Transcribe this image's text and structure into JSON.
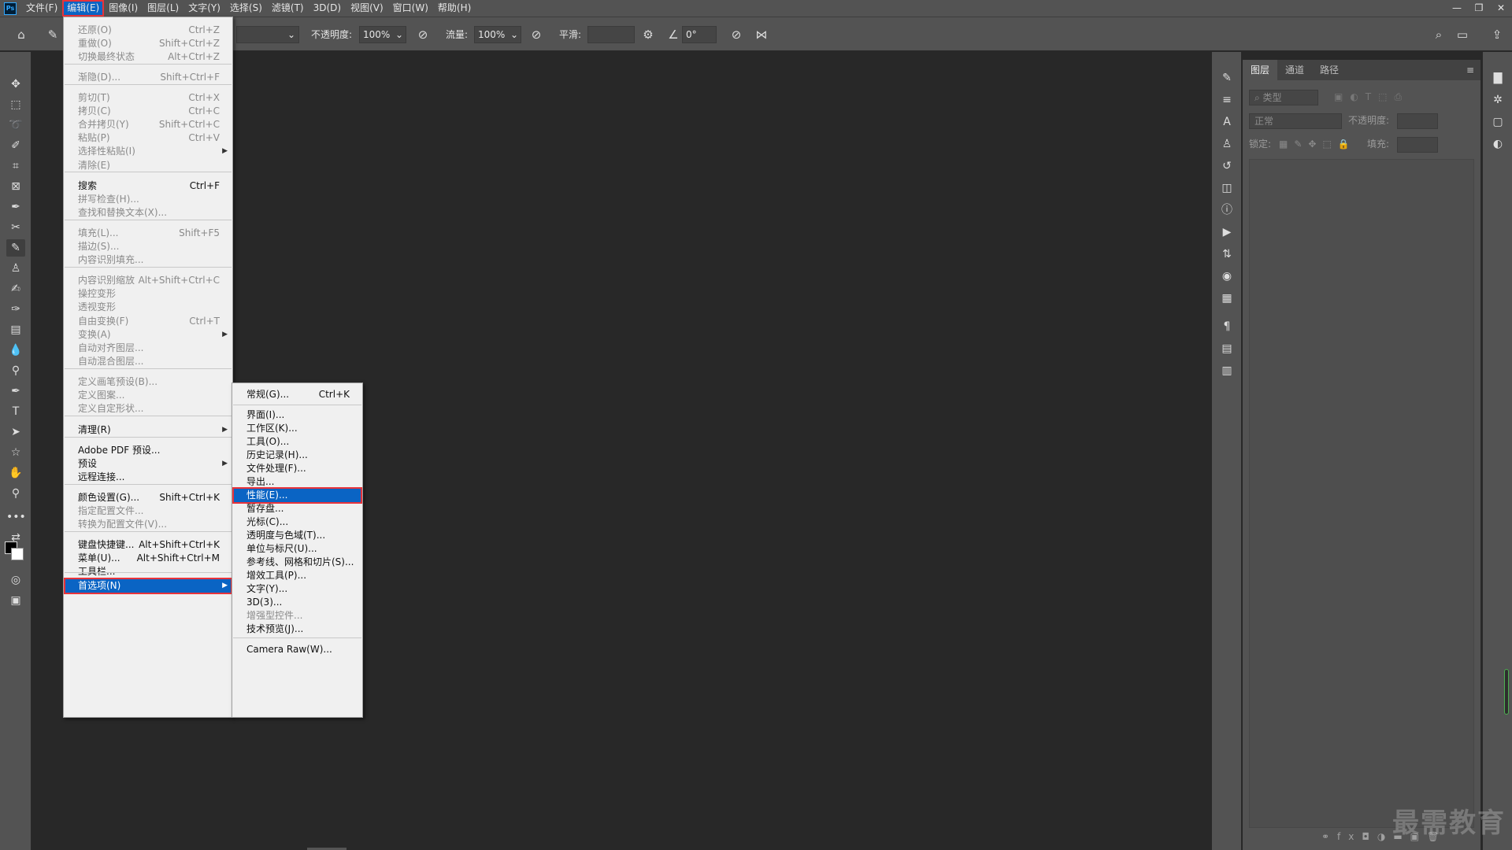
{
  "app": {
    "logo": "Ps"
  },
  "menubar": {
    "items": [
      "文件(F)",
      "编辑(E)",
      "图像(I)",
      "图层(L)",
      "文字(Y)",
      "选择(S)",
      "滤镜(T)",
      "3D(D)",
      "视图(V)",
      "窗口(W)",
      "帮助(H)"
    ],
    "active_index": 1,
    "window_controls": [
      "—",
      "❐",
      "✕"
    ]
  },
  "options": {
    "opacity_label": "不透明度:",
    "opacity_value": "100%",
    "flow_label": "流量:",
    "flow_value": "100%",
    "smoothing_label": "平滑:",
    "smoothing_value": "",
    "angle_value": "0°"
  },
  "edit_menu": {
    "items": [
      {
        "label": "还原(O)",
        "shortcut": "Ctrl+Z",
        "enabled": false
      },
      {
        "label": "重做(O)",
        "shortcut": "Shift+Ctrl+Z",
        "enabled": false
      },
      {
        "label": "切换最终状态",
        "shortcut": "Alt+Ctrl+Z",
        "enabled": false
      },
      {
        "label": "渐隐(D)...",
        "shortcut": "Shift+Ctrl+F",
        "enabled": false
      },
      {
        "label": "剪切(T)",
        "shortcut": "Ctrl+X",
        "enabled": false
      },
      {
        "label": "拷贝(C)",
        "shortcut": "Ctrl+C",
        "enabled": false
      },
      {
        "label": "合并拷贝(Y)",
        "shortcut": "Shift+Ctrl+C",
        "enabled": false
      },
      {
        "label": "粘贴(P)",
        "shortcut": "Ctrl+V",
        "enabled": false
      },
      {
        "label": "选择性粘贴(I)",
        "shortcut": "",
        "enabled": false,
        "submenu": true
      },
      {
        "label": "清除(E)",
        "shortcut": "",
        "enabled": false
      },
      {
        "label": "搜索",
        "shortcut": "Ctrl+F",
        "enabled": true
      },
      {
        "label": "拼写检查(H)...",
        "shortcut": "",
        "enabled": false
      },
      {
        "label": "查找和替换文本(X)...",
        "shortcut": "",
        "enabled": false
      },
      {
        "label": "填充(L)...",
        "shortcut": "Shift+F5",
        "enabled": false
      },
      {
        "label": "描边(S)...",
        "shortcut": "",
        "enabled": false
      },
      {
        "label": "内容识别填充...",
        "shortcut": "",
        "enabled": false
      },
      {
        "label": "内容识别缩放",
        "shortcut": "Alt+Shift+Ctrl+C",
        "enabled": false
      },
      {
        "label": "操控变形",
        "shortcut": "",
        "enabled": false
      },
      {
        "label": "透视变形",
        "shortcut": "",
        "enabled": false
      },
      {
        "label": "自由变换(F)",
        "shortcut": "Ctrl+T",
        "enabled": false
      },
      {
        "label": "变换(A)",
        "shortcut": "",
        "enabled": false,
        "submenu": true
      },
      {
        "label": "自动对齐图层...",
        "shortcut": "",
        "enabled": false
      },
      {
        "label": "自动混合图层...",
        "shortcut": "",
        "enabled": false
      },
      {
        "label": "定义画笔预设(B)...",
        "shortcut": "",
        "enabled": false
      },
      {
        "label": "定义图案...",
        "shortcut": "",
        "enabled": false
      },
      {
        "label": "定义自定形状...",
        "shortcut": "",
        "enabled": false
      },
      {
        "label": "清理(R)",
        "shortcut": "",
        "enabled": true,
        "submenu": true
      },
      {
        "label": "Adobe PDF 预设...",
        "shortcut": "",
        "enabled": true
      },
      {
        "label": "预设",
        "shortcut": "",
        "enabled": true,
        "submenu": true
      },
      {
        "label": "远程连接...",
        "shortcut": "",
        "enabled": true
      },
      {
        "label": "颜色设置(G)...",
        "shortcut": "Shift+Ctrl+K",
        "enabled": true
      },
      {
        "label": "指定配置文件...",
        "shortcut": "",
        "enabled": false
      },
      {
        "label": "转换为配置文件(V)...",
        "shortcut": "",
        "enabled": false
      },
      {
        "label": "键盘快捷键...",
        "shortcut": "Alt+Shift+Ctrl+K",
        "enabled": true
      },
      {
        "label": "菜单(U)...",
        "shortcut": "Alt+Shift+Ctrl+M",
        "enabled": true
      },
      {
        "label": "工具栏...",
        "shortcut": "",
        "enabled": true
      },
      {
        "label": "首选项(N)",
        "shortcut": "",
        "enabled": true,
        "submenu": true,
        "highlighted": true
      }
    ]
  },
  "pref_menu": {
    "items": [
      {
        "label": "常规(G)...",
        "shortcut": "Ctrl+K",
        "enabled": true
      },
      {
        "label": "界面(I)...",
        "shortcut": "",
        "enabled": true
      },
      {
        "label": "工作区(K)...",
        "shortcut": "",
        "enabled": true
      },
      {
        "label": "工具(O)...",
        "shortcut": "",
        "enabled": true
      },
      {
        "label": "历史记录(H)...",
        "shortcut": "",
        "enabled": true
      },
      {
        "label": "文件处理(F)...",
        "shortcut": "",
        "enabled": true
      },
      {
        "label": "导出...",
        "shortcut": "",
        "enabled": true
      },
      {
        "label": "性能(E)...",
        "shortcut": "",
        "enabled": true,
        "highlighted": true
      },
      {
        "label": "暂存盘...",
        "shortcut": "",
        "enabled": true
      },
      {
        "label": "光标(C)...",
        "shortcut": "",
        "enabled": true
      },
      {
        "label": "透明度与色域(T)...",
        "shortcut": "",
        "enabled": true
      },
      {
        "label": "单位与标尺(U)...",
        "shortcut": "",
        "enabled": true
      },
      {
        "label": "参考线、网格和切片(S)...",
        "shortcut": "",
        "enabled": true
      },
      {
        "label": "增效工具(P)...",
        "shortcut": "",
        "enabled": true
      },
      {
        "label": "文字(Y)...",
        "shortcut": "",
        "enabled": true
      },
      {
        "label": "3D(3)...",
        "shortcut": "",
        "enabled": true
      },
      {
        "label": "增强型控件...",
        "shortcut": "",
        "enabled": false
      },
      {
        "label": "技术预览(J)...",
        "shortcut": "",
        "enabled": true
      },
      {
        "label": "Camera Raw(W)...",
        "shortcut": "",
        "enabled": true
      }
    ]
  },
  "layers_panel": {
    "tabs": [
      "图层",
      "通道",
      "路径"
    ],
    "filter_label": "类型",
    "blend_mode": "正常",
    "opacity_label": "不透明度:",
    "lock_label": "锁定:",
    "fill_label": "填充:"
  },
  "watermark": "最需教育",
  "colors": {
    "highlight": "#0a64c4",
    "red_box": "#e8333a"
  }
}
